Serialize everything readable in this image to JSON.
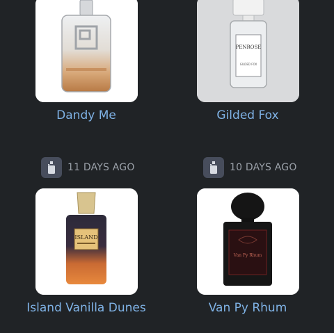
{
  "perfumes": [
    {
      "name": "Dandy Me",
      "image_icon": "perfume-bottle-icon"
    },
    {
      "name": "Gilded Fox",
      "image_icon": "perfume-bottle-icon",
      "bottle_label": "PENROSE",
      "bottle_sublabel": "GILDED FOX"
    },
    {
      "name": "Island Vanilla Dunes",
      "image_icon": "perfume-bottle-icon",
      "added": "11 DAYS AGO",
      "bottle_label": "ISLAND"
    },
    {
      "name": "Van Py Rhum",
      "image_icon": "perfume-bottle-icon",
      "added": "10 DAYS AGO",
      "bottle_label": "Van Py Rhum"
    }
  ],
  "colors": {
    "background": "#202326",
    "accent": "#7fb2e5",
    "meta_text": "#9aa0a8",
    "icon_bg": "#474d5c"
  }
}
